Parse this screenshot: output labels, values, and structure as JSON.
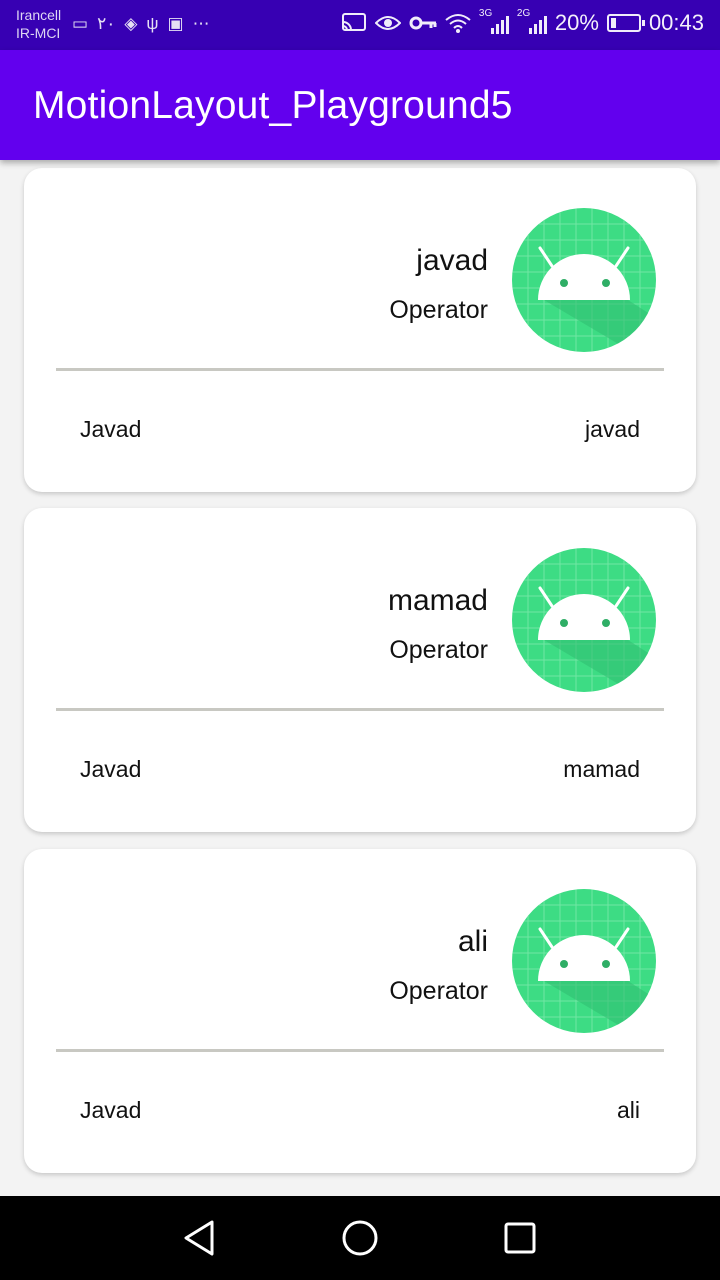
{
  "status_bar": {
    "carrier_line1": "Irancell",
    "carrier_line2": "IR-MCI",
    "left_icons": [
      "video-icon",
      "persian-digits-icon",
      "diamond-icon",
      "usb-icon",
      "image-icon",
      "more-icon"
    ],
    "left_glyphs": [
      "▭",
      "۲۰",
      "◈",
      "ψ",
      "▣",
      "⋯"
    ],
    "network1": "3G",
    "network2": "2G",
    "battery_percent": "20%",
    "battery_level": 0.2,
    "time": "00:43"
  },
  "app_bar": {
    "title": "MotionLayout_Playground5"
  },
  "cards": [
    {
      "name": "javad",
      "role": "Operator",
      "footer_left": "Javad",
      "footer_right": "javad"
    },
    {
      "name": "mamad",
      "role": "Operator",
      "footer_left": "Javad",
      "footer_right": "mamad"
    },
    {
      "name": "ali",
      "role": "Operator",
      "footer_left": "Javad",
      "footer_right": "ali"
    }
  ],
  "nav_bar": {
    "back_icon": "back-triangle-icon",
    "home_icon": "home-circle-icon",
    "recents_icon": "recents-square-icon"
  },
  "colors": {
    "status_bar": "#3700b3",
    "app_bar": "#6200ee",
    "avatar_green": "#3ddc84",
    "nav_bar": "#000000"
  }
}
